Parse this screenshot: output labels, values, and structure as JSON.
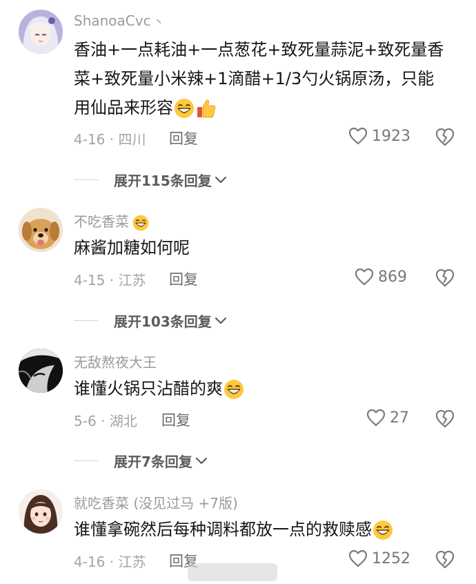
{
  "comments": [
    {
      "username": "ShanoaCvc",
      "username_suffix": "丶",
      "content": "香油+一点耗油+一点葱花+致死量蒜泥+致死量香菜+致死量小米辣+1滴醋+1/3勺火锅原汤，只能用仙品来形容",
      "meta": "4-16 · 四川",
      "reply_label": "回复",
      "likes": "1923",
      "expand_label": "展开115条回复"
    },
    {
      "username": "不吃香菜",
      "content": "麻酱加糖如何呢",
      "meta": "4-15 · 江苏",
      "reply_label": "回复",
      "likes": "869",
      "expand_label": "展开103条回复"
    },
    {
      "username": "无敌熬夜大王",
      "content": "谁懂火锅只沾醋的爽",
      "meta": "5-6 · 湖北",
      "reply_label": "回复",
      "likes": "27",
      "expand_label": "展开7条回复"
    },
    {
      "username": "就吃香菜 (没见过马 +7版)",
      "content": "谁懂拿碗然后每种调料都放一点的救赎感",
      "meta": "4-16 · 江苏",
      "reply_label": "回复",
      "likes": "1252"
    }
  ],
  "colors": {
    "username": "#9a9a9a",
    "content": "#161616",
    "meta": "#a3a3a3",
    "icon": "#7a7a7a"
  },
  "icons": [
    "heart-outline-icon",
    "broken-heart-icon",
    "chevron-down-icon",
    "grin-emoji",
    "thumbs-up-emoji"
  ]
}
